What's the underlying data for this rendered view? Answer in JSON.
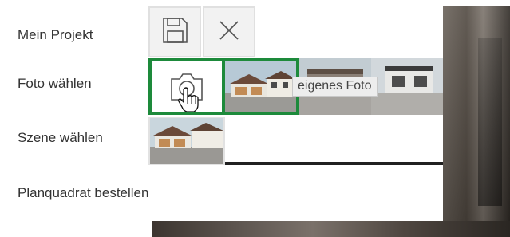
{
  "menu": {
    "items": [
      {
        "label": "Mein Projekt"
      },
      {
        "label": "Foto wählen"
      },
      {
        "label": "Szene wählen"
      },
      {
        "label": "Planquadrat bestellen"
      }
    ]
  },
  "toolbar": {
    "save_icon": "save-icon",
    "close_icon": "close-icon"
  },
  "photo_row": {
    "camera_icon": "camera-icon",
    "tooltip": "eigenes Foto"
  },
  "colors": {
    "accent": "#1d8a3b",
    "text": "#333333",
    "tooltip_bg": "#ededed"
  }
}
